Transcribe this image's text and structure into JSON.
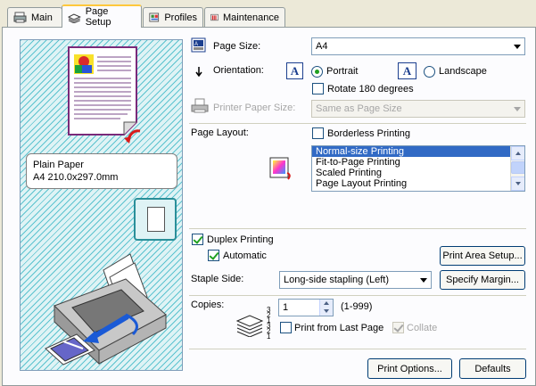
{
  "tabs": [
    {
      "label": "Main",
      "active": false
    },
    {
      "label": "Page Setup",
      "active": true
    },
    {
      "label": "Profiles",
      "active": false
    },
    {
      "label": "Maintenance",
      "active": false
    }
  ],
  "preview": {
    "paper_type": "Plain Paper",
    "paper_dims": "A4 210.0x297.0mm"
  },
  "page_size": {
    "label": "Page Size:",
    "value": "A4"
  },
  "orientation": {
    "label": "Orientation:",
    "portrait": "Portrait",
    "landscape": "Landscape",
    "selected": "Portrait",
    "icon_letter": "A"
  },
  "rotate": {
    "label": "Rotate 180 degrees",
    "checked": false
  },
  "printer_paper_size": {
    "label": "Printer Paper Size:",
    "value": "Same as Page Size",
    "disabled": true
  },
  "page_layout": {
    "label": "Page Layout:",
    "borderless": {
      "label": "Borderless Printing",
      "checked": false
    },
    "options": [
      "Normal-size Printing",
      "Fit-to-Page Printing",
      "Scaled Printing",
      "Page Layout Printing"
    ],
    "selected_index": 0
  },
  "duplex": {
    "label": "Duplex Printing",
    "checked": true
  },
  "automatic": {
    "label": "Automatic",
    "checked": true
  },
  "print_area_setup": "Print Area Setup...",
  "staple_side": {
    "label": "Staple Side:",
    "value": "Long-side stapling (Left)"
  },
  "specify_margin": "Specify Margin...",
  "copies": {
    "label": "Copies:",
    "value": "1",
    "range": "(1-999)",
    "stack_digits": "3 2 1 3 2 1",
    "print_from_last": {
      "label": "Print from Last Page",
      "checked": false
    },
    "collate": {
      "label": "Collate",
      "checked": true,
      "disabled": true
    }
  },
  "buttons": {
    "print_options": "Print Options...",
    "defaults": "Defaults"
  },
  "colors": {
    "accent_tab": "#ffc83c",
    "hatch": "#5cc3cf",
    "selection": "#316ac5",
    "check": "#21a121"
  }
}
